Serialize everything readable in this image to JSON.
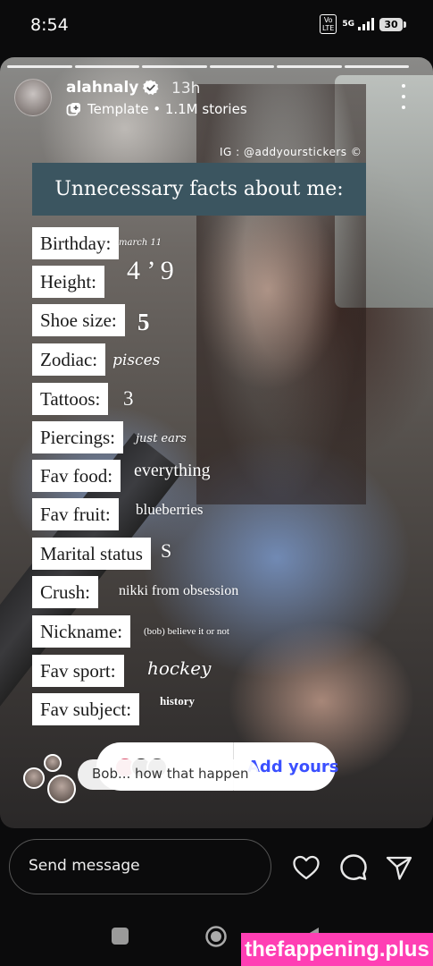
{
  "status_bar": {
    "time": "8:54",
    "volte": "Vo\nLTE",
    "network": "5G",
    "battery": "30"
  },
  "story": {
    "username": "alahnaly",
    "time_ago": "13h",
    "template_line": "Template • 1.1M stories",
    "credit": "IG : @addyourstickers ©",
    "title": "Unnecessary facts about me:",
    "facts": [
      {
        "label": "Birthday:",
        "answer": "march 11"
      },
      {
        "label": "Height:",
        "answer": "4 ’ 9"
      },
      {
        "label": "Shoe size:",
        "answer": "5"
      },
      {
        "label": "Zodiac:",
        "answer": "pisces"
      },
      {
        "label": "Tattoos:",
        "answer": "3"
      },
      {
        "label": "Piercings:",
        "answer": "just ears"
      },
      {
        "label": "Fav food:",
        "answer": "everything"
      },
      {
        "label": "Fav fruit:",
        "answer": "blueberries"
      },
      {
        "label": "Marital status",
        "answer": "S"
      },
      {
        "label": "Crush:",
        "answer": "nikki from obsession"
      },
      {
        "label": "Nickname:",
        "answer": "(bob) believe it or not"
      },
      {
        "label": "Fav sport:",
        "answer": "hockey"
      },
      {
        "label": "Fav subject:",
        "answer": "history"
      }
    ],
    "add_yours_label": "Add yours",
    "reply_preview": "Bob... how that happen"
  },
  "composer": {
    "placeholder": "Send message"
  },
  "icons": [
    "verified-badge-icon",
    "template-icon",
    "more-options-icon",
    "heart-icon",
    "reply-icon",
    "share-icon",
    "recents-icon",
    "home-icon",
    "back-icon"
  ],
  "colors": {
    "title_box": "#3b5560",
    "add_yours": "#3b50ff",
    "watermark": "#ff3fb4"
  },
  "watermark": "thefappening.plus"
}
